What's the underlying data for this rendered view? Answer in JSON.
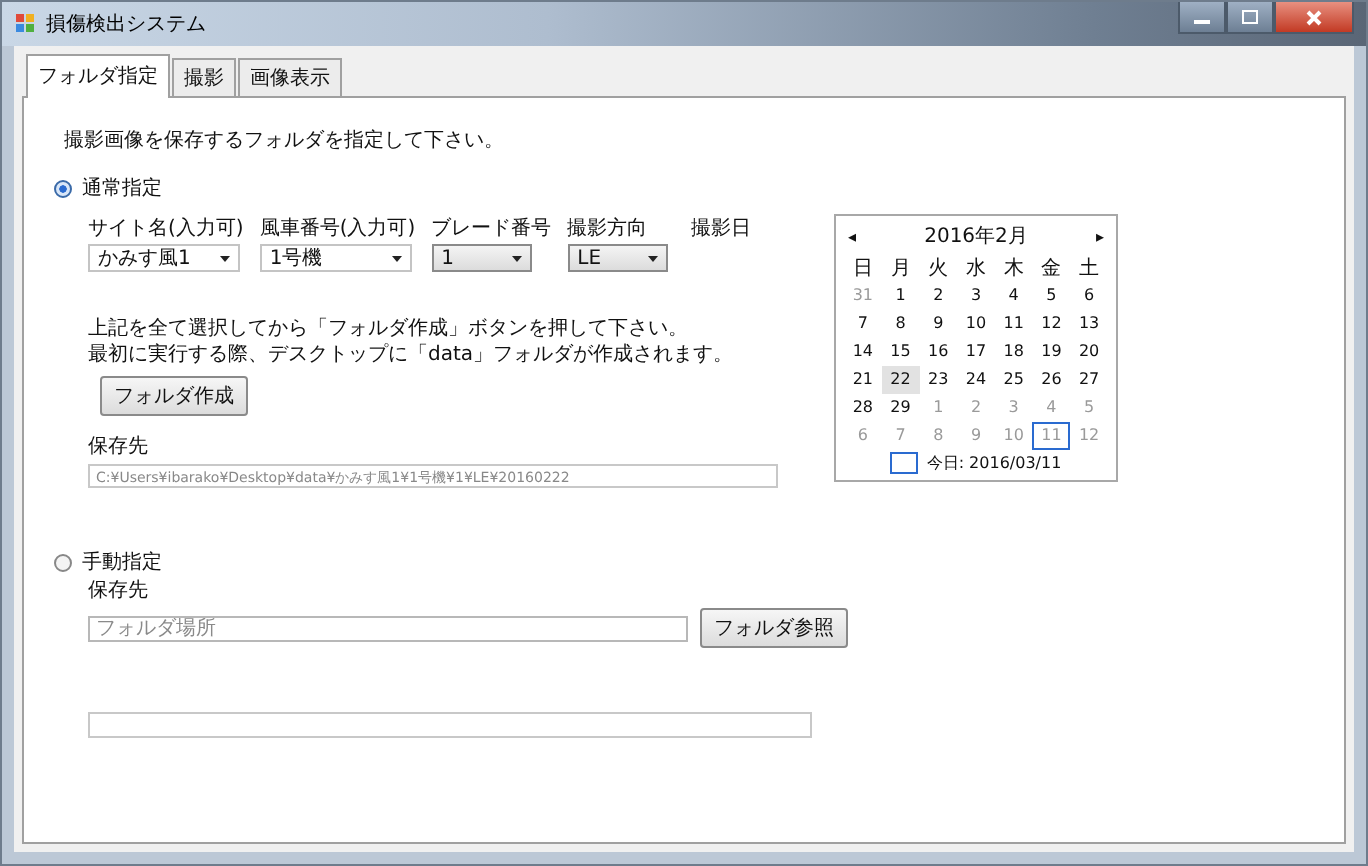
{
  "window": {
    "title": "損傷検出システム"
  },
  "tabs": [
    {
      "label": "フォルダ指定",
      "selected": true
    },
    {
      "label": "撮影",
      "selected": false
    },
    {
      "label": "画像表示",
      "selected": false
    }
  ],
  "instruction": "撮影画像を保存するフォルダを指定して下さい。",
  "normal": {
    "label": "通常指定",
    "selected": true,
    "fields": [
      {
        "label": "サイト名(入力可)",
        "value": "かみす風1",
        "kind": "combo"
      },
      {
        "label": "風車番号(入力可)",
        "value": "1号機",
        "kind": "combo"
      },
      {
        "label": "ブレード番号",
        "value": "1",
        "kind": "dropdown"
      },
      {
        "label": "撮影方向",
        "value": "LE",
        "kind": "dropdown"
      }
    ],
    "date_label": "撮影日",
    "notes": [
      "上記を全て選択してから「フォルダ作成」ボタンを押して下さい。",
      "最初に実行する際、デスクトップに「data」フォルダが作成されます。"
    ],
    "create_button": "フォルダ作成",
    "path_label": "保存先",
    "path_value": "C:¥Users¥ibarako¥Desktop¥data¥かみす風1¥1号機¥1¥LE¥20160222"
  },
  "calendar": {
    "prev": "◂",
    "month": "2016年2月",
    "next": "▸",
    "weekdays": [
      "日",
      "月",
      "火",
      "水",
      "木",
      "金",
      "土"
    ],
    "weeks": [
      [
        {
          "d": "31",
          "other": true
        },
        {
          "d": "1"
        },
        {
          "d": "2"
        },
        {
          "d": "3"
        },
        {
          "d": "4"
        },
        {
          "d": "5"
        },
        {
          "d": "6"
        }
      ],
      [
        {
          "d": "7"
        },
        {
          "d": "8"
        },
        {
          "d": "9"
        },
        {
          "d": "10"
        },
        {
          "d": "11"
        },
        {
          "d": "12"
        },
        {
          "d": "13"
        }
      ],
      [
        {
          "d": "14"
        },
        {
          "d": "15"
        },
        {
          "d": "16"
        },
        {
          "d": "17"
        },
        {
          "d": "18"
        },
        {
          "d": "19"
        },
        {
          "d": "20"
        }
      ],
      [
        {
          "d": "21"
        },
        {
          "d": "22",
          "selected": true
        },
        {
          "d": "23"
        },
        {
          "d": "24"
        },
        {
          "d": "25"
        },
        {
          "d": "26"
        },
        {
          "d": "27"
        }
      ],
      [
        {
          "d": "28"
        },
        {
          "d": "29"
        },
        {
          "d": "1",
          "other": true
        },
        {
          "d": "2",
          "other": true
        },
        {
          "d": "3",
          "other": true
        },
        {
          "d": "4",
          "other": true
        },
        {
          "d": "5",
          "other": true
        }
      ],
      [
        {
          "d": "6",
          "other": true
        },
        {
          "d": "7",
          "other": true
        },
        {
          "d": "8",
          "other": true
        },
        {
          "d": "9",
          "other": true
        },
        {
          "d": "10",
          "other": true
        },
        {
          "d": "11",
          "other": true,
          "today": true
        },
        {
          "d": "12",
          "other": true
        }
      ]
    ],
    "today": "今日: 2016/03/11"
  },
  "manual": {
    "label": "手動指定",
    "selected": false,
    "path_label": "保存先",
    "placeholder": "フォルダ場所",
    "browse_button": "フォルダ参照"
  }
}
